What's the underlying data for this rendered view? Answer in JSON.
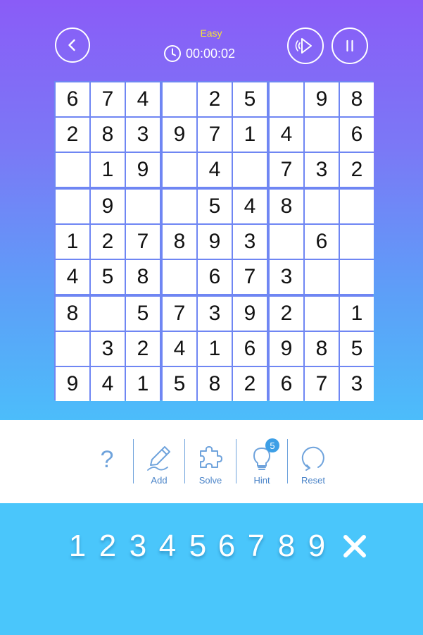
{
  "header": {
    "difficulty": "Easy",
    "timer": "00:00:02",
    "back_icon": "chevron-left-icon",
    "sound_icon": "speaker-icon",
    "pause_icon": "pause-icon"
  },
  "board": {
    "rows": [
      [
        "6",
        "7",
        "4",
        "",
        "2",
        "5",
        "",
        "9",
        "8"
      ],
      [
        "2",
        "8",
        "3",
        "9",
        "7",
        "1",
        "4",
        "",
        "6"
      ],
      [
        "",
        "1",
        "9",
        "",
        "4",
        "",
        "7",
        "3",
        "2"
      ],
      [
        "",
        "9",
        "",
        "",
        "5",
        "4",
        "8",
        "",
        ""
      ],
      [
        "1",
        "2",
        "7",
        "8",
        "9",
        "3",
        "",
        "6",
        ""
      ],
      [
        "4",
        "5",
        "8",
        "",
        "6",
        "7",
        "3",
        "",
        ""
      ],
      [
        "8",
        "",
        "5",
        "7",
        "3",
        "9",
        "2",
        "",
        "1"
      ],
      [
        "",
        "3",
        "2",
        "4",
        "1",
        "6",
        "9",
        "8",
        "5"
      ],
      [
        "9",
        "4",
        "1",
        "5",
        "8",
        "2",
        "6",
        "7",
        "3"
      ]
    ]
  },
  "toolbar": {
    "help_label": "?",
    "add_label": "Add",
    "solve_label": "Solve",
    "hint_label": "Hint",
    "hint_count": "5",
    "reset_label": "Reset"
  },
  "numpad": {
    "numbers": [
      "1",
      "2",
      "3",
      "4",
      "5",
      "6",
      "7",
      "8",
      "9"
    ],
    "erase_icon": "close-icon"
  },
  "colors": {
    "gradient_top": "#8a5cf7",
    "gradient_bottom": "#4cbdfa",
    "accent": "#4b84c8",
    "numpad_bg": "#4ac6fb",
    "difficulty": "#f4e13b"
  }
}
